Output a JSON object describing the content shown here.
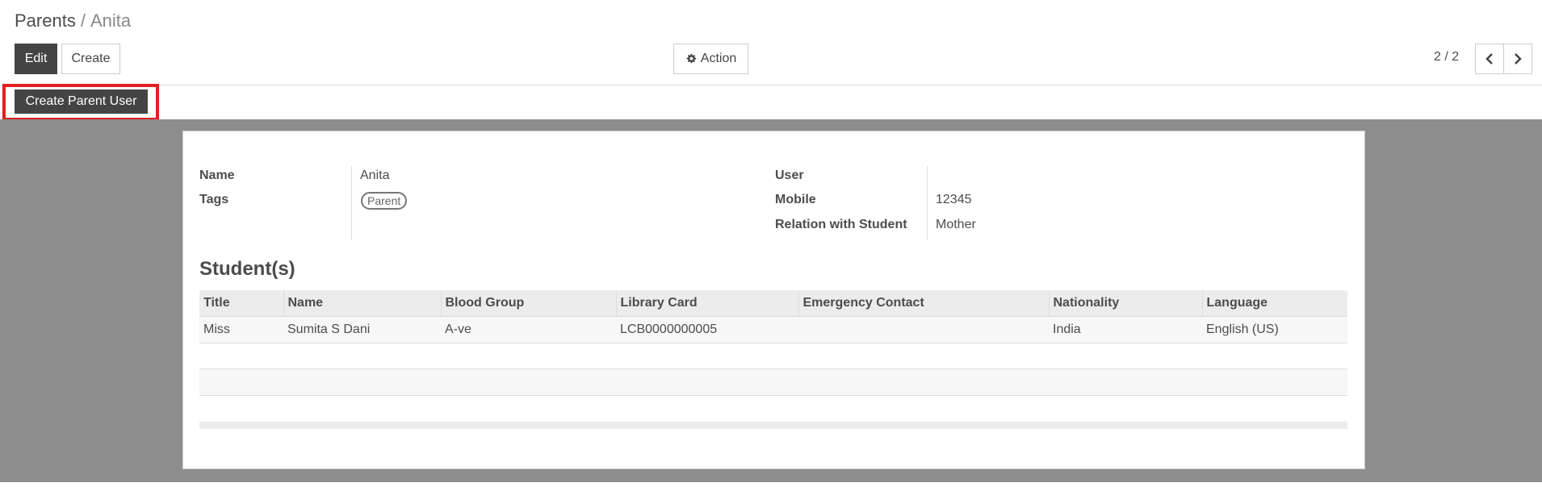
{
  "breadcrumb": {
    "parent": "Parents",
    "separator": "/",
    "current": "Anita"
  },
  "toolbar": {
    "edit_label": "Edit",
    "create_label": "Create",
    "action_label": "Action",
    "action_icon": "gear-icon"
  },
  "pager": {
    "value": "2 / 2"
  },
  "statusbar": {
    "create_parent_user_label": "Create Parent User"
  },
  "form": {
    "name_label": "Name",
    "name_value": "Anita",
    "tags_label": "Tags",
    "tags": [
      "Parent"
    ],
    "user_label": "User",
    "user_value": "",
    "mobile_label": "Mobile",
    "mobile_value": "12345",
    "relation_label": "Relation with Student",
    "relation_value": "Mother"
  },
  "students": {
    "title": "Student(s)",
    "columns": [
      "Title",
      "Name",
      "Blood Group",
      "Library Card",
      "Emergency Contact",
      "Nationality",
      "Language"
    ],
    "rows": [
      [
        "Miss",
        "Sumita S Dani",
        "A-ve",
        "LCB0000000005",
        "",
        "India",
        "English (US)"
      ]
    ]
  },
  "colors": {
    "primary_button": "#444444",
    "highlight": "#e02020",
    "sheet_background": "#8d8d8d"
  }
}
